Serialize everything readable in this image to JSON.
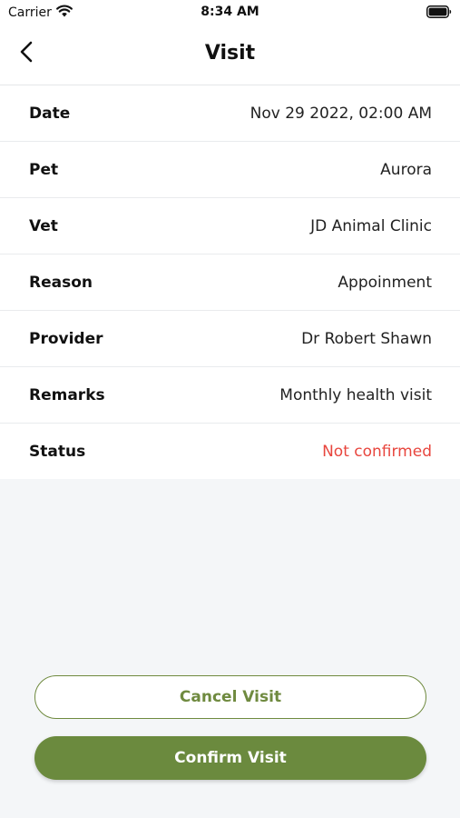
{
  "status_bar": {
    "carrier": "Carrier",
    "time": "8:34 AM"
  },
  "header": {
    "title": "Visit"
  },
  "details": [
    {
      "label": "Date",
      "value": "Nov 29 2022, 02:00 AM"
    },
    {
      "label": "Pet",
      "value": "Aurora"
    },
    {
      "label": "Vet",
      "value": "JD Animal Clinic"
    },
    {
      "label": "Reason",
      "value": "Appoinment"
    },
    {
      "label": "Provider",
      "value": "Dr Robert Shawn"
    },
    {
      "label": "Remarks",
      "value": "Monthly health visit"
    },
    {
      "label": "Status",
      "value": "Not confirmed"
    }
  ],
  "actions": {
    "cancel_label": "Cancel Visit",
    "confirm_label": "Confirm Visit"
  },
  "colors": {
    "accent": "#6b8a3e",
    "status_not_confirmed": "#e8463e",
    "background": "#f4f6f8"
  },
  "icons": {
    "wifi": "wifi-icon",
    "battery": "battery-icon",
    "back": "chevron-left-icon"
  }
}
